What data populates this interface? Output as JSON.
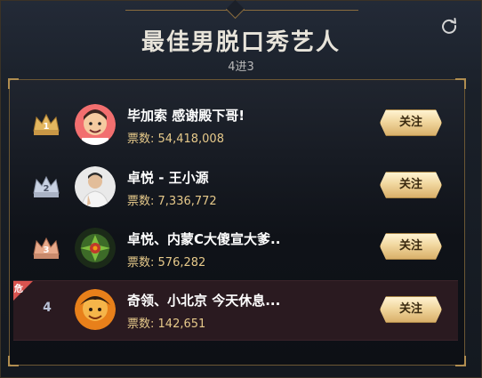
{
  "header": {
    "title": "最佳男脱口秀艺人",
    "subtitle": "4进3"
  },
  "icons": {
    "refresh": "refresh-icon"
  },
  "colors": {
    "gold": "#e6c98a",
    "button_gold": "#f1d79f",
    "danger": "#d9534f"
  },
  "candidates": [
    {
      "rank": "1",
      "rank_medal": "gold-crown",
      "name": "毕加索 感谢殿下哥!",
      "votes_label": "票数:",
      "votes": "54,418,008",
      "follow_label": "关注"
    },
    {
      "rank": "2",
      "rank_medal": "silver-crown",
      "name": "卓悦 - 王小源",
      "votes_label": "票数:",
      "votes": "7,336,772",
      "follow_label": "关注"
    },
    {
      "rank": "3",
      "rank_medal": "bronze-crown",
      "name": "卓悦、内蒙C大傻宣大爹..",
      "votes_label": "票数:",
      "votes": "576,282",
      "follow_label": "关注"
    },
    {
      "rank": "4",
      "rank_medal": "none",
      "name": "奇领、小北京 今天休息...",
      "votes_label": "票数:",
      "votes": "142,651",
      "follow_label": "关注",
      "danger_tag": "危"
    }
  ]
}
